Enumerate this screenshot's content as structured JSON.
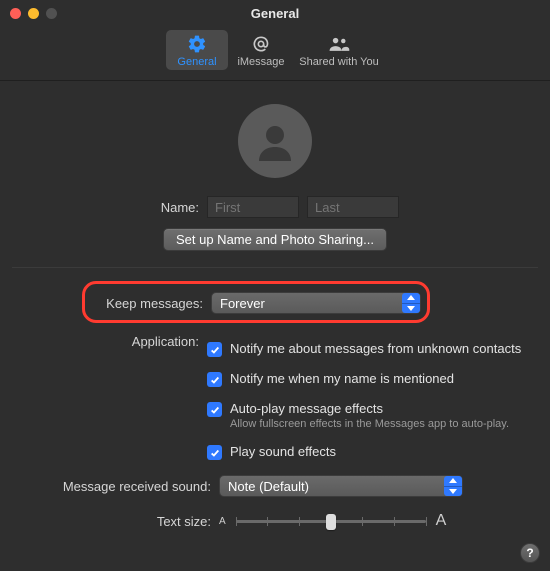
{
  "window": {
    "title": "General"
  },
  "toolbar": {
    "items": [
      {
        "label": "General"
      },
      {
        "label": "iMessage"
      },
      {
        "label": "Shared with You"
      }
    ]
  },
  "name": {
    "label": "Name:",
    "first_placeholder": "First",
    "last_placeholder": "Last"
  },
  "setup_button": "Set up Name and Photo Sharing...",
  "keep_messages": {
    "label": "Keep messages:",
    "value": "Forever"
  },
  "application": {
    "label": "Application:",
    "opt1": "Notify me about messages from unknown contacts",
    "opt2": "Notify me when my name is mentioned",
    "opt3": "Auto-play message effects",
    "opt3_sub": "Allow fullscreen effects in the Messages app to auto-play.",
    "opt4": "Play sound effects"
  },
  "sound": {
    "label": "Message received sound:",
    "value": "Note (Default)"
  },
  "text_size": {
    "label": "Text size:",
    "small": "A",
    "large": "A"
  },
  "help": "?",
  "highlight_color": "#ff3b30",
  "accent": "#2f79ff"
}
